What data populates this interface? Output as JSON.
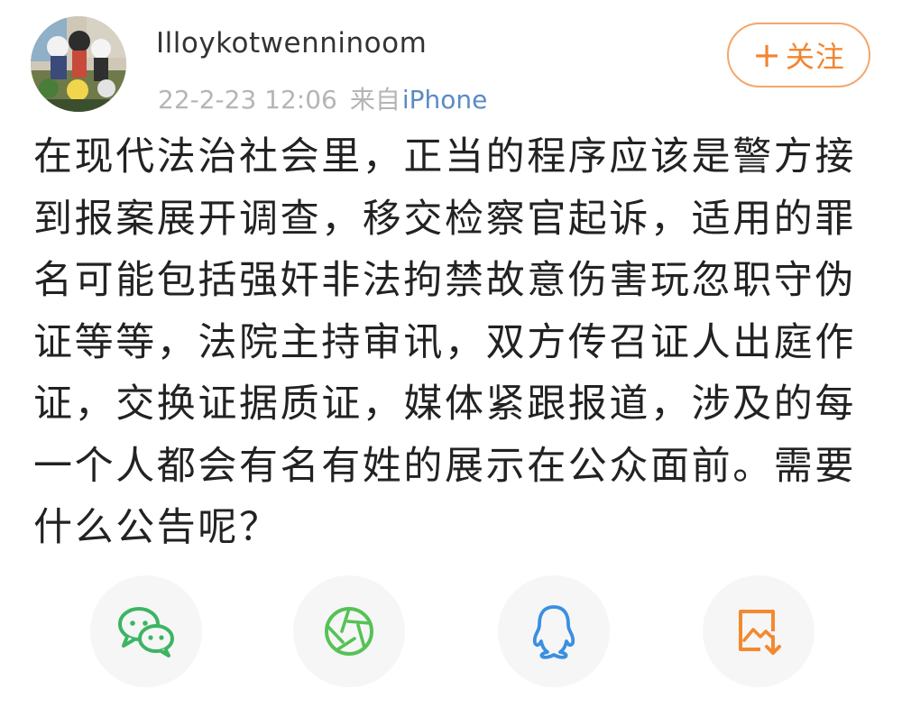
{
  "post": {
    "author": {
      "username": "Illoykotwenninoom"
    },
    "meta": {
      "timestamp": "22-2-23 12:06",
      "source_prefix": "来自",
      "source_device": "iPhone"
    },
    "follow_button_label": "关注",
    "body_text": "在现代法治社会里，正当的程序应该是警方接到报案展开调查，移交检察官起诉，适用的罪名可能包括强奸非法拘禁故意伤害玩忽职守伪证等等，法院主持审讯，双方传召证人出庭作证，交换证据质证，媒体紧跟报道，涉及的每一个人都会有名有姓的展示在公众面前。需要什么公告呢？"
  },
  "share_actions": [
    {
      "id": "wechat",
      "icon": "wechat-icon",
      "color": "#3cb563"
    },
    {
      "id": "moments",
      "icon": "moments-icon",
      "color": "#56c255"
    },
    {
      "id": "qq",
      "icon": "qq-icon",
      "color": "#3a8fe0"
    },
    {
      "id": "save_image",
      "icon": "save-image-icon",
      "color": "#f2892f"
    }
  ],
  "colors": {
    "accent_orange": "#f28430",
    "link_blue": "#5a8bc4",
    "meta_gray": "#b5b5b5",
    "text_dark": "#222222"
  }
}
